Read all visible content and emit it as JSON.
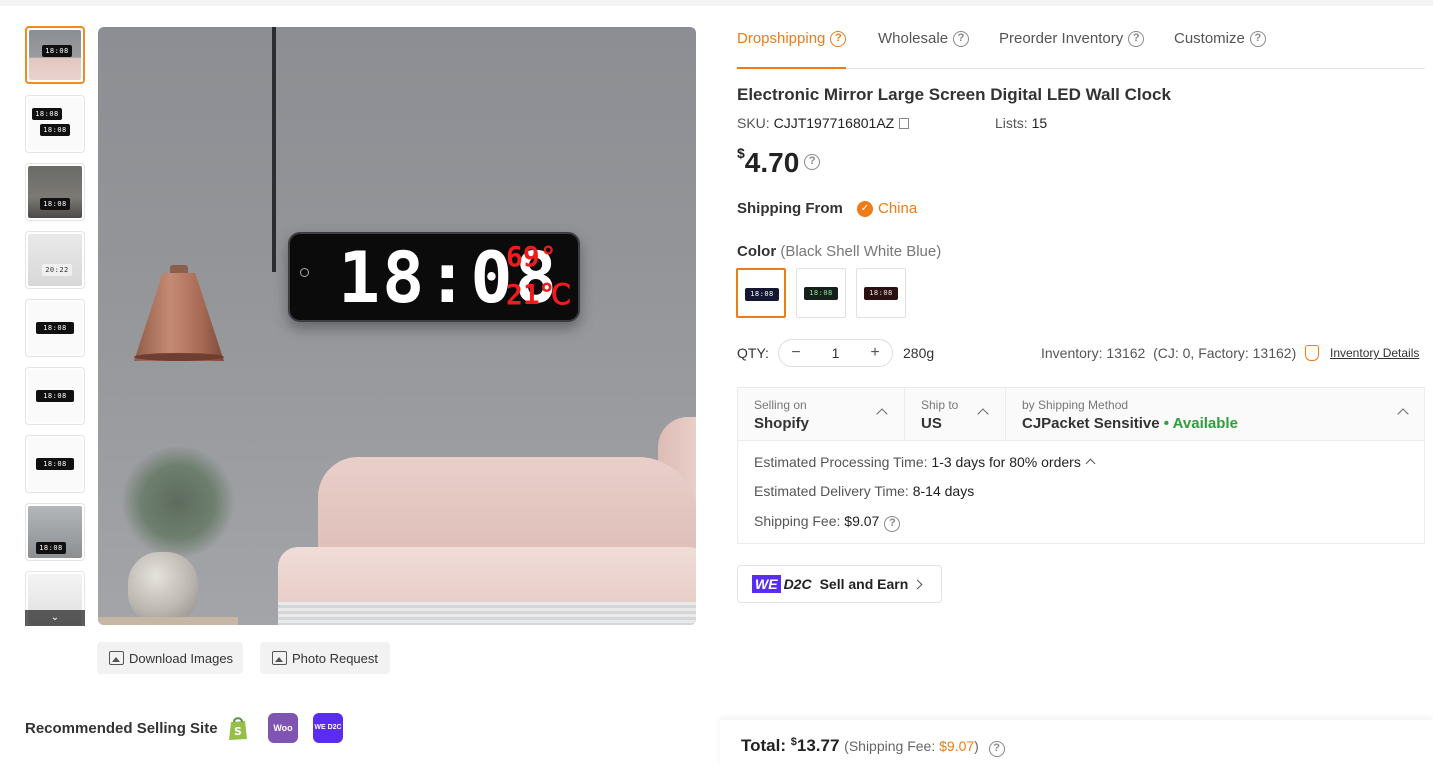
{
  "tabs": [
    {
      "label": "Dropshipping",
      "active": true
    },
    {
      "label": "Wholesale",
      "active": false
    },
    {
      "label": "Preorder Inventory",
      "active": false
    },
    {
      "label": "Customize",
      "active": false
    }
  ],
  "product": {
    "title": "Electronic Mirror Large Screen Digital LED Wall Clock",
    "sku_label": "SKU:",
    "sku": "CJJT197716801AZ",
    "lists_label": "Lists:",
    "lists": "15",
    "currency": "$",
    "price": "4.70"
  },
  "main_image": {
    "clock_time": "18:08",
    "clock_temp_f": "69°",
    "clock_temp_c": "21℃"
  },
  "thumbnails": [
    {
      "clock": "18:08"
    },
    {
      "clock": "18:08"
    },
    {
      "clock": "18:08"
    },
    {
      "clock": "20:22"
    },
    {
      "clock": "18:08"
    },
    {
      "clock": "18:08"
    },
    {
      "clock": "18:08"
    },
    {
      "clock": "18:08"
    },
    {
      "clock": ""
    }
  ],
  "image_buttons": {
    "download": "Download Images",
    "photo_request": "Photo Request"
  },
  "shipping_from": {
    "label": "Shipping From",
    "value": "China"
  },
  "color": {
    "label": "Color",
    "selected": "(Black Shell White Blue)",
    "swatch_clock": "18:08"
  },
  "qty": {
    "label": "QTY:",
    "minus": "−",
    "value": "1",
    "plus": "+",
    "weight": "280g"
  },
  "inventory": {
    "text": "Inventory: 13162",
    "detail": "(CJ: 0, Factory: 13162)",
    "link": "Inventory Details"
  },
  "shipping": {
    "selling_on_label": "Selling on",
    "selling_on": "Shopify",
    "ship_to_label": "Ship to",
    "ship_to": "US",
    "method_label": "by Shipping Method",
    "method": "CJPacket Sensitive",
    "availability": "• Available",
    "processing_label": "Estimated Processing Time:",
    "processing": "1-3 days for 80% orders",
    "delivery_label": "Estimated Delivery Time:",
    "delivery": "8-14 days",
    "fee_label": "Shipping Fee:",
    "fee": "$9.07"
  },
  "promo": {
    "we": "WE",
    "d2c": "D2C",
    "label": "Sell and Earn"
  },
  "recommended": {
    "label": "Recommended Selling Site",
    "sites": [
      {
        "name": "shopify-icon",
        "text": "",
        "color": "#95bf47"
      },
      {
        "name": "woocommerce-icon",
        "text": "Woo",
        "color": "#7f54b3"
      },
      {
        "name": "wed2c-icon",
        "text": "WE D2C",
        "color": "#5a2cf0"
      }
    ]
  },
  "total": {
    "label": "Total:",
    "currency": "$",
    "amount": "13.77",
    "fee_open": "(Shipping Fee: ",
    "fee": "$9.07",
    "fee_close": ")"
  },
  "colors": {
    "accent": "#f07b16",
    "available": "#2e9e3a"
  }
}
